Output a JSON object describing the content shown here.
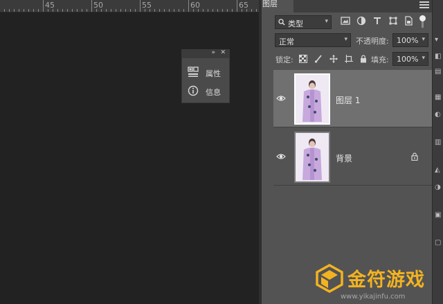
{
  "ruler": {
    "labels": [
      "45",
      "50",
      "55",
      "60",
      "65"
    ]
  },
  "float_panel": {
    "items": [
      {
        "label": "属性",
        "icon": "properties-icon"
      },
      {
        "label": "信息",
        "icon": "info-icon"
      }
    ]
  },
  "layers_panel": {
    "tab_label": "图层",
    "filter": {
      "kind_value": "类型"
    },
    "blend_mode": "正常",
    "opacity_label": "不透明度:",
    "opacity_value": "100%",
    "lock_label": "锁定:",
    "fill_label": "填充:",
    "fill_value": "100%",
    "layers": [
      {
        "name": "图层 1",
        "selected": true,
        "visible": true,
        "locked": false
      },
      {
        "name": "背景",
        "selected": false,
        "visible": true,
        "locked": true
      }
    ]
  },
  "watermark": {
    "name": "金符游戏",
    "url": "www.yikajinfu.com",
    "accent": "#f3b321"
  }
}
